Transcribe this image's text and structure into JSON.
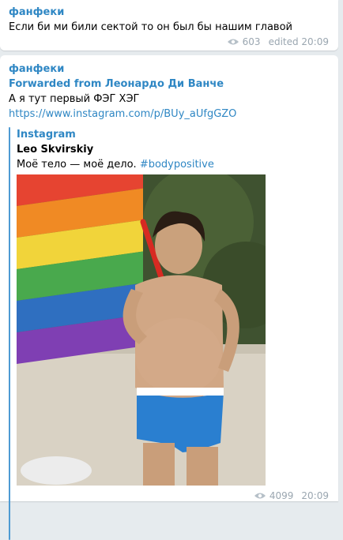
{
  "messages": [
    {
      "author": "фанфеки",
      "text": "Если би ми били сектой то он был бы нашим главой",
      "views": "603",
      "time": "edited 20:09"
    },
    {
      "author": "фанфеки",
      "forwarded": "Forwarded from Леонардо Ди Ванче",
      "text": "А я тут первый ФЭГ ХЭГ",
      "link": "https://www.instagram.com/p/BUy_aUfgGZO",
      "preview": {
        "site": "Instagram",
        "title": "Leo Skvirskiy",
        "desc_plain": "Моё тело — моё дело.",
        "hashtag": "#bodypositive"
      },
      "views": "4099",
      "time": "20:09"
    }
  ],
  "colors": {
    "accent": "#2f87c4",
    "meta": "#9aa6b0",
    "background": "#e6ebee"
  },
  "icons": {
    "views": "eye-icon"
  }
}
